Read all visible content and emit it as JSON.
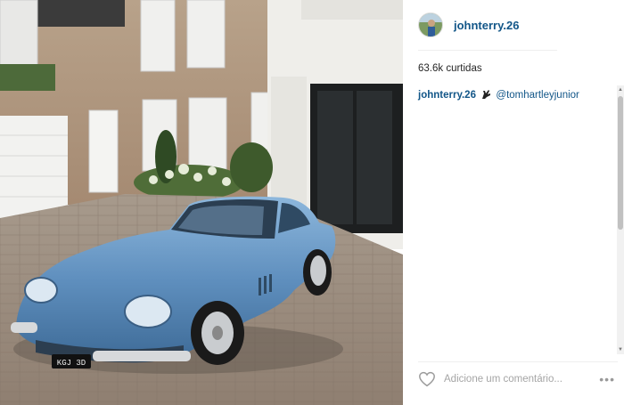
{
  "post": {
    "username": "johnterry.26",
    "likes_text": "63.6k curtidas",
    "caption": {
      "username": "johnterry.26",
      "mention": "@tomhartleyjunior"
    },
    "comment_placeholder": "Adicione um comentário...",
    "more_label": "•••",
    "plate_text": "KGJ 3D"
  },
  "icons": {
    "heart": "heart-outline-icon",
    "more": "ellipsis-icon",
    "caption_emoji": "hand-emoji-icon"
  },
  "colors": {
    "username": "#125688",
    "text": "#262626",
    "placeholder": "#a5a5a5",
    "car_body": "#6f9ec8"
  }
}
